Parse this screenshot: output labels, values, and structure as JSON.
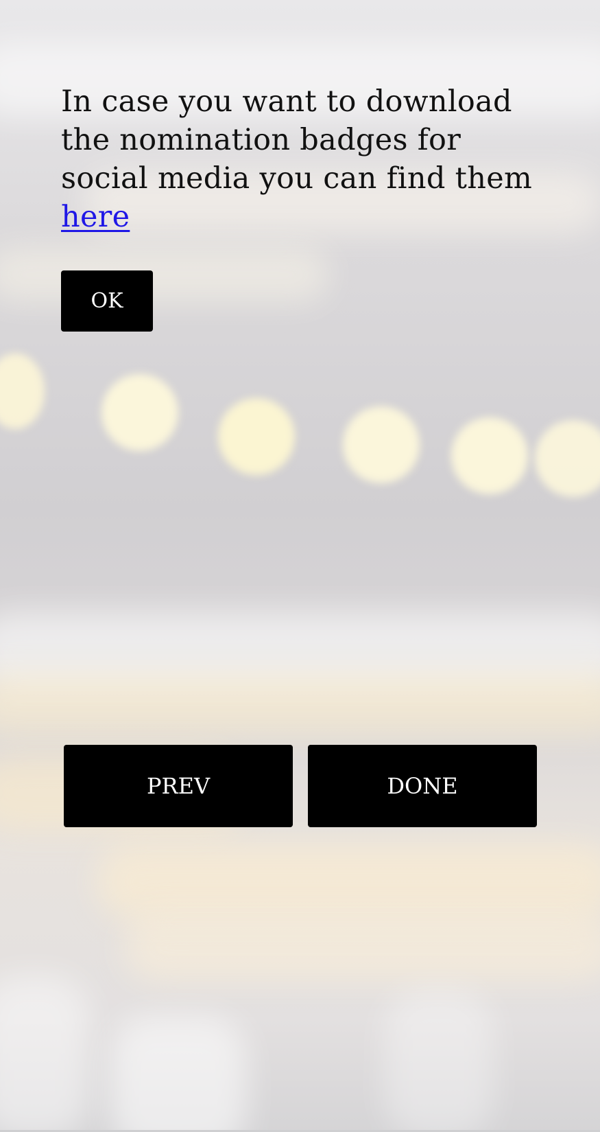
{
  "dialog": {
    "message_text": "In case you want to download the nomination badges for social media you can find them ",
    "link_text": "here",
    "ok_label": "OK"
  },
  "navigation": {
    "prev_label": "PREV",
    "done_label": "DONE"
  },
  "colors": {
    "button_bg": "#000000",
    "button_text": "#ffffff",
    "link": "#1f17e6",
    "text": "#111111"
  }
}
